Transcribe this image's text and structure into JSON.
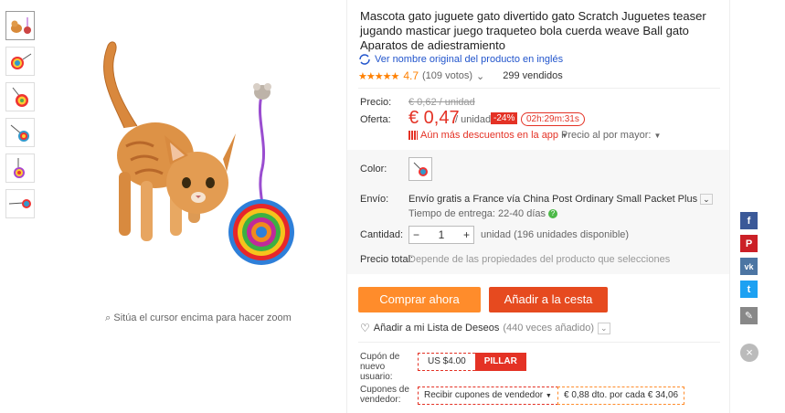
{
  "product": {
    "title": "Mascota gato juguete gato divertido gato Scratch Juguetes teaser jugando masticar juego traqueteo bola cuerda weave Ball gato Aparatos de adiestramiento",
    "original_name_link": "Ver nombre original del producto en inglés",
    "stars": "★★★★★",
    "rating": "4.7",
    "votes": "(109 votos)",
    "sold": "299 vendidos"
  },
  "price": {
    "price_label": "Precio:",
    "old_price": "€ 0,62 / unidad",
    "offer_label": "Oferta:",
    "new_price": "€ 0,47",
    "per_unit": "/ unidad",
    "discount": "-24%",
    "timer": "02h:29m:31s",
    "more_discounts": "Aún más descuentos en la app",
    "bulk_price": "Precio al por mayor:"
  },
  "options": {
    "color_label": "Color:",
    "shipping_label": "Envío:",
    "shipping_text": "Envío gratis a France vía China Post Ordinary Small Packet Plus",
    "delivery_time": "Tiempo de entrega: 22-40 días",
    "quantity_label": "Cantidad:",
    "quantity_value": "1",
    "available": "unidad (196 unidades disponible)",
    "total_label": "Precio total:",
    "total_hint": "Depende de las propiedades del producto que selecciones"
  },
  "actions": {
    "buy_now": "Comprar ahora",
    "add_to_cart": "Añadir a la cesta",
    "wishlist": "Añadir a mi Lista de Deseos",
    "wishlist_count": "(440 veces añadido)"
  },
  "coupons": {
    "new_user_label": "Cupón de nuevo usuario:",
    "new_user_amount": "US $4.00",
    "grab": "PILLAR",
    "seller_label": "Cupones de vendedor:",
    "seller_receive": "Recibir cupones de vendedor",
    "seller_offer": "€ 0,88 dto. por cada € 34,06"
  },
  "zoom_hint": "Sitúa el cursor encima para hacer zoom",
  "social": [
    {
      "name": "facebook",
      "glyph": "f",
      "color": "#3b5998"
    },
    {
      "name": "pinterest",
      "glyph": "P",
      "color": "#cb2027"
    },
    {
      "name": "vk",
      "glyph": "vk",
      "color": "#4c75a3"
    },
    {
      "name": "twitter",
      "glyph": "t",
      "color": "#1da1f2"
    },
    {
      "name": "edit",
      "glyph": "✎",
      "color": "#888888"
    }
  ]
}
